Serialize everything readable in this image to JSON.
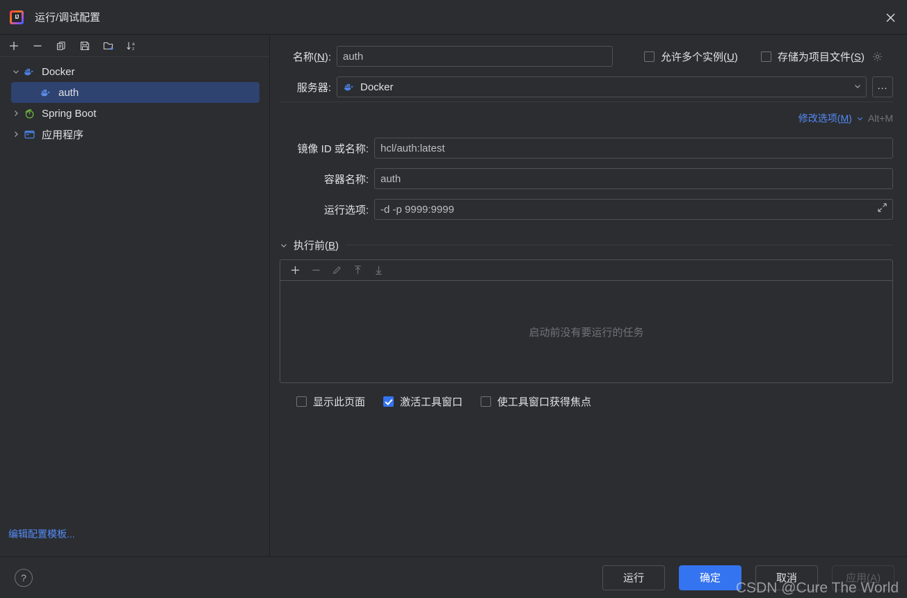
{
  "window": {
    "title": "运行/调试配置",
    "app_icon": "intellij-idea-icon",
    "close_icon": "close-icon"
  },
  "sidebar": {
    "toolbar": [
      {
        "name": "add-configuration-button",
        "icon": "plus-icon",
        "glyph": "+"
      },
      {
        "name": "remove-configuration-button",
        "icon": "minus-icon",
        "glyph": "−"
      },
      {
        "name": "copy-configuration-button",
        "icon": "copy-icon",
        "glyph": "copy"
      },
      {
        "name": "save-configuration-button",
        "icon": "save-floppy-icon",
        "glyph": "save"
      },
      {
        "name": "new-folder-button",
        "icon": "new-folder-icon",
        "glyph": "folder-plus"
      },
      {
        "name": "sort-configurations-button",
        "icon": "sort-alphabetical-icon",
        "glyph": "sort-az"
      }
    ],
    "tree": [
      {
        "label": "Docker",
        "icon": "docker-whale-icon",
        "expanded": true,
        "level": 0,
        "selected": false,
        "twisty": "⌄"
      },
      {
        "label": "auth",
        "icon": "docker-whale-icon",
        "expanded": null,
        "level": 1,
        "selected": true,
        "twisty": ""
      },
      {
        "label": "Spring Boot",
        "icon": "spring-boot-icon",
        "expanded": false,
        "level": 0,
        "selected": false,
        "twisty": "›"
      },
      {
        "label": "应用程序",
        "icon": "application-icon",
        "expanded": false,
        "level": 0,
        "selected": false,
        "twisty": "›"
      }
    ],
    "edit_templates_link": "编辑配置模板..."
  },
  "form": {
    "name_label": "名称(N):",
    "name_label_plain": "名称(",
    "name_mnemonic": "N",
    "name_label_tail": "):",
    "name_value": "auth",
    "allow_multiple_label": "允许多个实例(U)",
    "allow_multiple_text": "允许多个实例(",
    "allow_multiple_mnemonic": "U",
    "allow_multiple_checked": false,
    "store_as_project_file_text": "存储为项目文件(",
    "store_as_project_file_mnemonic": "S",
    "store_as_project_file_checked": false,
    "gear_icon": "gear-icon",
    "server_label": "服务器:",
    "server_value": "Docker",
    "server_icon": "docker-whale-icon",
    "server_dropdown_icon": "chevron-down-icon",
    "server_browse_label": "...",
    "modify_options_text": "修改选项(",
    "modify_options_mnemonic": "M",
    "modify_options_tail": ")",
    "modify_options_shortcut": "Alt+M",
    "image_label": "镜像 ID 或名称:",
    "image_value": "hcl/auth:latest",
    "container_label": "容器名称:",
    "container_value": "auth",
    "run_options_label": "运行选项:",
    "run_options_value": "-d -p 9999:9999",
    "expand_icon": "expand-editor-icon"
  },
  "before_launch": {
    "title_text": "执行前(",
    "title_mnemonic": "B",
    "title_tail": ")",
    "collapse_icon": "chevron-down-icon",
    "toolbar": [
      {
        "name": "add-task-button",
        "icon": "plus-icon",
        "glyph": "+",
        "disabled": false
      },
      {
        "name": "remove-task-button",
        "icon": "minus-icon",
        "glyph": "−",
        "disabled": true
      },
      {
        "name": "edit-task-button",
        "icon": "pencil-icon",
        "glyph": "edit",
        "disabled": true
      },
      {
        "name": "move-up-button",
        "icon": "arrow-up-icon",
        "glyph": "up",
        "disabled": true
      },
      {
        "name": "move-down-button",
        "icon": "arrow-down-icon",
        "glyph": "down",
        "disabled": true
      }
    ],
    "empty_message": "启动前没有要运行的任务",
    "checkboxes": [
      {
        "label": "显示此页面",
        "checked": false,
        "name": "show-this-page-checkbox"
      },
      {
        "label": "激活工具窗口",
        "checked": true,
        "name": "activate-tool-window-checkbox"
      },
      {
        "label": "使工具窗口获得焦点",
        "checked": false,
        "name": "focus-tool-window-checkbox"
      }
    ]
  },
  "footer": {
    "help_label": "?",
    "run_label": "运行",
    "ok_label": "确定",
    "cancel_label": "取消",
    "apply_text": "应用(",
    "apply_mnemonic": "A",
    "apply_tail": ")",
    "apply_disabled": true,
    "watermark": "CSDN @Cure The World"
  },
  "colors": {
    "background": "#2b2d30",
    "border": "#1e1f22",
    "field_border": "#4e5157",
    "accent": "#3574f0",
    "link": "#548af7",
    "selection": "#2f4371",
    "muted_text": "#6f737a",
    "docker_blue": "#4a80e0",
    "spring_green": "#6cab3c"
  }
}
